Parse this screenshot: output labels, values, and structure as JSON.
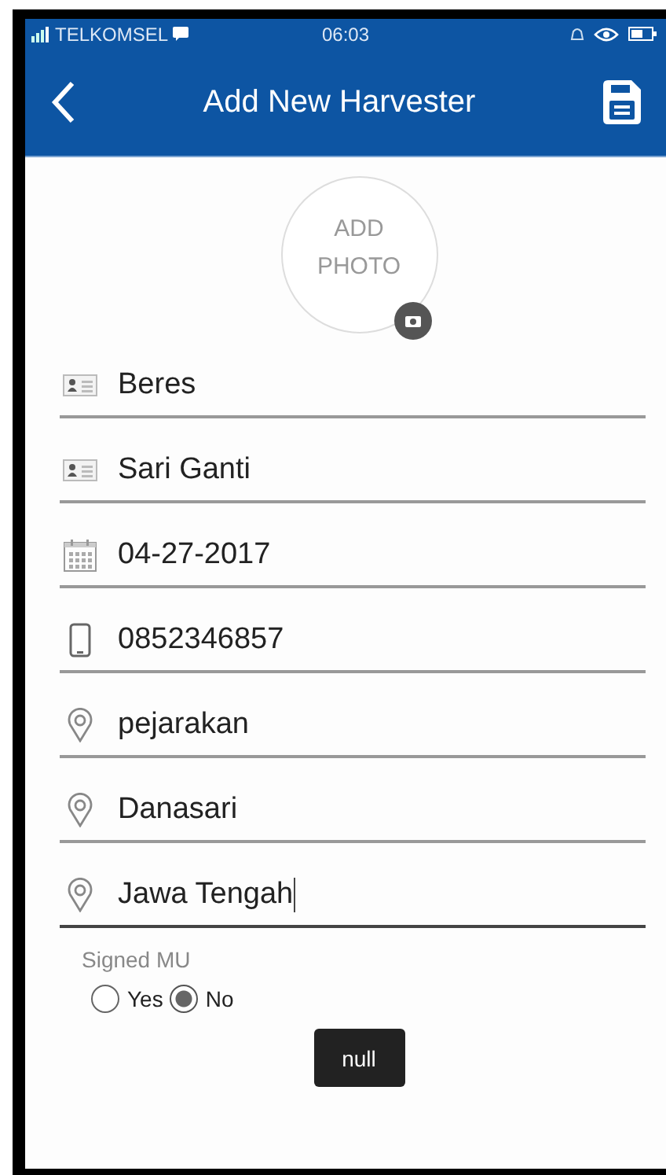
{
  "status_bar": {
    "carrier": "TELKOMSEL",
    "time": "06:03"
  },
  "app_bar": {
    "title": "Add New Harvester"
  },
  "photo": {
    "label_line1": "ADD",
    "label_line2": "PHOTO"
  },
  "fields": [
    {
      "kind": "card",
      "value": "Beres",
      "focused": false
    },
    {
      "kind": "card",
      "value": "Sari Ganti",
      "focused": false
    },
    {
      "kind": "calendar",
      "value": "04-27-2017",
      "focused": false
    },
    {
      "kind": "phone",
      "value": "0852346857",
      "focused": false
    },
    {
      "kind": "pin",
      "value": "pejarakan",
      "focused": false
    },
    {
      "kind": "pin",
      "value": "Danasari",
      "focused": false
    },
    {
      "kind": "pin",
      "value": "Jawa Tengah",
      "focused": true
    }
  ],
  "signed_mu": {
    "label": "Signed MU",
    "options": [
      {
        "label": "Yes",
        "selected": false
      },
      {
        "label": "No",
        "selected": true
      }
    ]
  },
  "button": {
    "label": "null"
  }
}
